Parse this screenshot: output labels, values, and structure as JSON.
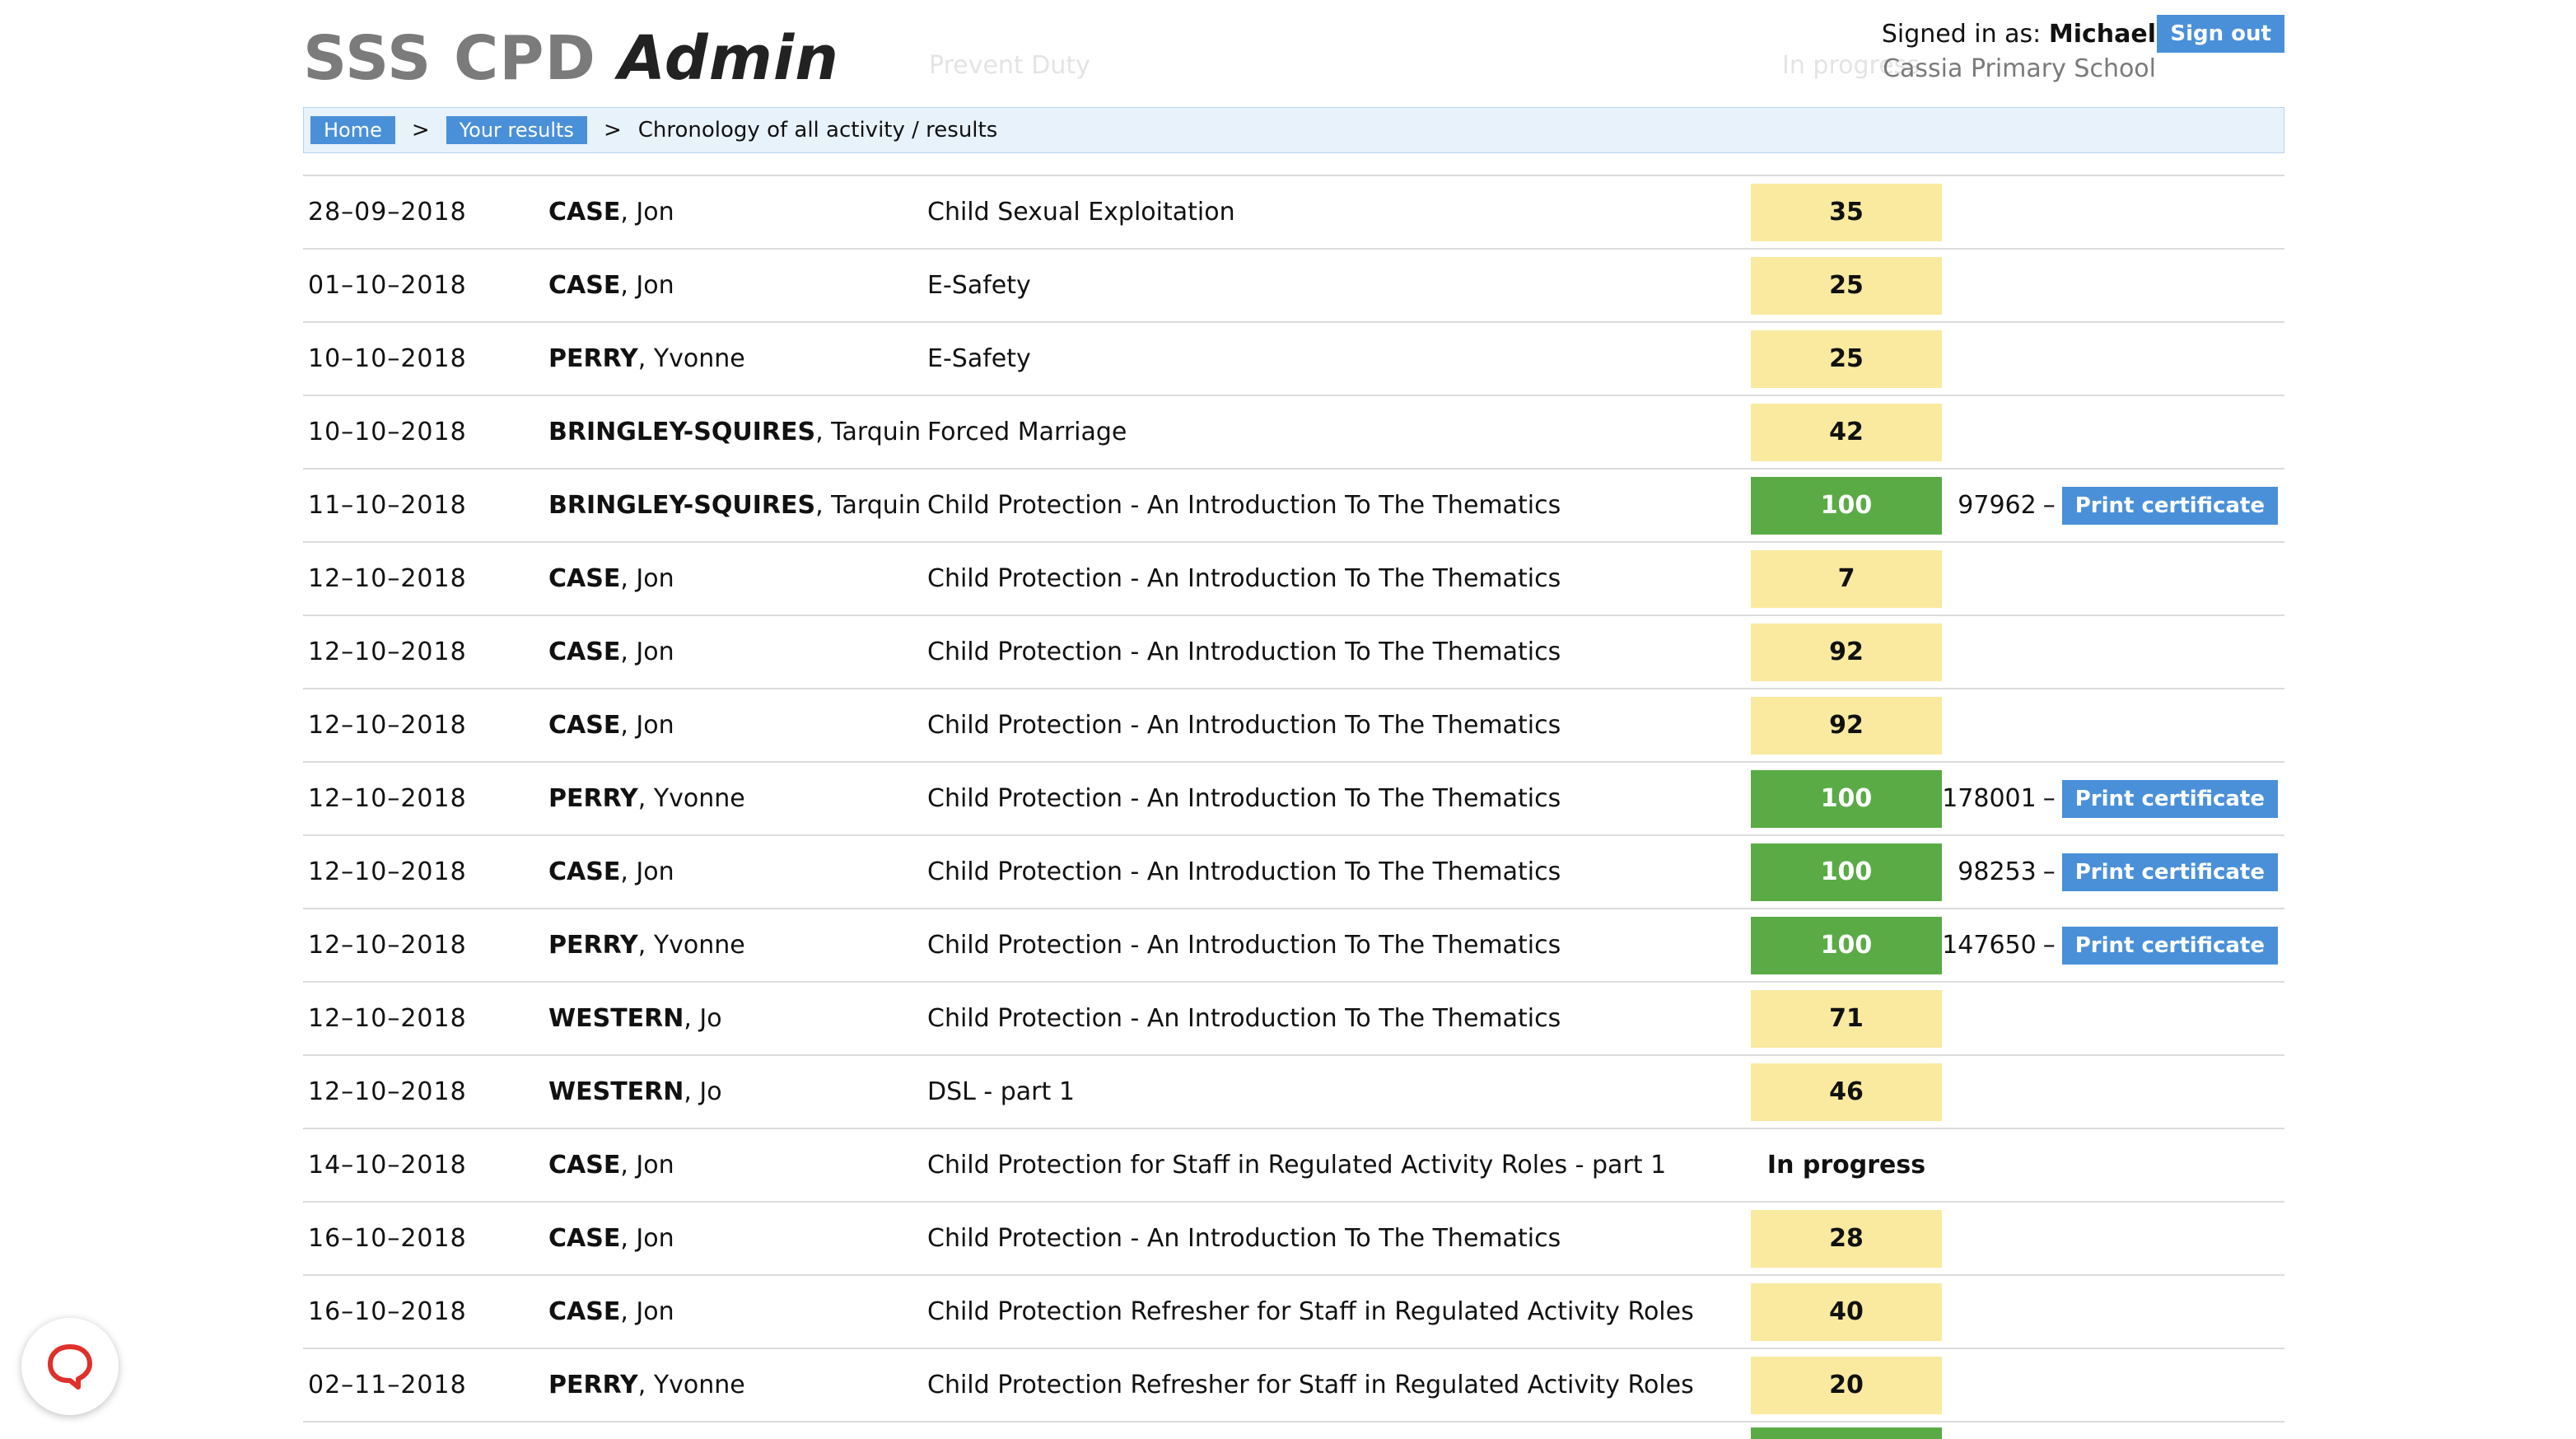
{
  "app": {
    "brand_prefix": "SSS CPD",
    "brand_suffix": "Admin"
  },
  "user": {
    "signed_in_label": "Signed in as:",
    "name": "Michael",
    "school": "Cassia Primary School",
    "sign_out_label": "Sign out"
  },
  "ghost_row": {
    "course": "Prevent Duty",
    "status": "In progress"
  },
  "breadcrumb": {
    "home": "Home",
    "results": "Your results",
    "separator": ">",
    "current": "Chronology of all activity / results"
  },
  "rows": [
    {
      "date": "28–09–2018",
      "surname": "CASE",
      "firstname": ", Jon",
      "course": "Child Sexual Exploitation",
      "score": "35",
      "status": "pending",
      "cert_number": "",
      "cert_dash": "",
      "print_label": ""
    },
    {
      "date": "01–10–2018",
      "surname": "CASE",
      "firstname": ", Jon",
      "course": "E-Safety",
      "score": "25",
      "status": "pending",
      "cert_number": "",
      "cert_dash": "",
      "print_label": ""
    },
    {
      "date": "10–10–2018",
      "surname": "PERRY",
      "firstname": ", Yvonne",
      "course": "E-Safety",
      "score": "25",
      "status": "pending",
      "cert_number": "",
      "cert_dash": "",
      "print_label": ""
    },
    {
      "date": "10–10–2018",
      "surname": "BRINGLEY-SQUIRES",
      "firstname": ", Tarquin",
      "course": "Forced Marriage",
      "score": "42",
      "status": "pending",
      "cert_number": "",
      "cert_dash": "",
      "print_label": ""
    },
    {
      "date": "11–10–2018",
      "surname": "BRINGLEY-SQUIRES",
      "firstname": ", Tarquin",
      "course": "Child Protection - An Introduction To The Thematics",
      "score": "100",
      "status": "pass",
      "cert_number": "97962",
      "cert_dash": "–",
      "print_label": "Print certificate"
    },
    {
      "date": "12–10–2018",
      "surname": "CASE",
      "firstname": ", Jon",
      "course": "Child Protection - An Introduction To The Thematics",
      "score": "7",
      "status": "pending",
      "cert_number": "",
      "cert_dash": "",
      "print_label": ""
    },
    {
      "date": "12–10–2018",
      "surname": "CASE",
      "firstname": ", Jon",
      "course": "Child Protection - An Introduction To The Thematics",
      "score": "92",
      "status": "pending",
      "cert_number": "",
      "cert_dash": "",
      "print_label": ""
    },
    {
      "date": "12–10–2018",
      "surname": "CASE",
      "firstname": ", Jon",
      "course": "Child Protection - An Introduction To The Thematics",
      "score": "92",
      "status": "pending",
      "cert_number": "",
      "cert_dash": "",
      "print_label": ""
    },
    {
      "date": "12–10–2018",
      "surname": "PERRY",
      "firstname": ", Yvonne",
      "course": "Child Protection - An Introduction To The Thematics",
      "score": "100",
      "status": "pass",
      "cert_number": "178001",
      "cert_dash": "–",
      "print_label": "Print certificate"
    },
    {
      "date": "12–10–2018",
      "surname": "CASE",
      "firstname": ", Jon",
      "course": "Child Protection - An Introduction To The Thematics",
      "score": "100",
      "status": "pass",
      "cert_number": "98253",
      "cert_dash": "–",
      "print_label": "Print certificate"
    },
    {
      "date": "12–10–2018",
      "surname": "PERRY",
      "firstname": ", Yvonne",
      "course": "Child Protection - An Introduction To The Thematics",
      "score": "100",
      "status": "pass",
      "cert_number": "147650",
      "cert_dash": "–",
      "print_label": "Print certificate"
    },
    {
      "date": "12–10–2018",
      "surname": "WESTERN",
      "firstname": ", Jo",
      "course": "Child Protection - An Introduction To The Thematics",
      "score": "71",
      "status": "pending",
      "cert_number": "",
      "cert_dash": "",
      "print_label": ""
    },
    {
      "date": "12–10–2018",
      "surname": "WESTERN",
      "firstname": ", Jo",
      "course": "DSL - part 1",
      "score": "46",
      "status": "pending",
      "cert_number": "",
      "cert_dash": "",
      "print_label": ""
    },
    {
      "date": "14–10–2018",
      "surname": "CASE",
      "firstname": ", Jon",
      "course": "Child Protection for Staff in Regulated Activity Roles - part 1",
      "score": "In progress",
      "status": "progress",
      "cert_number": "",
      "cert_dash": "",
      "print_label": ""
    },
    {
      "date": "16–10–2018",
      "surname": "CASE",
      "firstname": ", Jon",
      "course": "Child Protection - An Introduction To The Thematics",
      "score": "28",
      "status": "pending",
      "cert_number": "",
      "cert_dash": "",
      "print_label": ""
    },
    {
      "date": "16–10–2018",
      "surname": "CASE",
      "firstname": ", Jon",
      "course": "Child Protection Refresher for Staff in Regulated Activity Roles",
      "score": "40",
      "status": "pending",
      "cert_number": "",
      "cert_dash": "",
      "print_label": ""
    },
    {
      "date": "02–11–2018",
      "surname": "PERRY",
      "firstname": ", Yvonne",
      "course": "Child Protection Refresher for Staff in Regulated Activity Roles",
      "score": "20",
      "status": "pending",
      "cert_number": "",
      "cert_dash": "",
      "print_label": ""
    }
  ],
  "chat_widget": {
    "icon": "chat-bubble-icon",
    "color": "#e0302a"
  },
  "colors": {
    "pass": "#5aab46",
    "pending": "#f9eaa0",
    "accent": "#4a90d9"
  }
}
